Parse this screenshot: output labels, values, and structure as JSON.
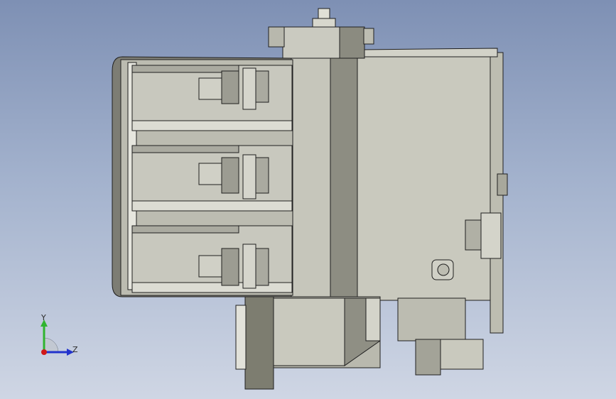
{
  "viewport": {
    "background_top": "#7e90b4",
    "background_bottom": "#cfd6e4"
  },
  "model": {
    "body_color": "#c3c3b8",
    "shadow_color": "#8f8f84",
    "edge_color": "#1f1f1f",
    "pole_count": 3
  },
  "triad": {
    "x_label": "",
    "y_label": "Y",
    "z_label": "Z",
    "y_color": "#2fb42f",
    "z_color": "#2233cc",
    "x_color": "#d01818"
  }
}
